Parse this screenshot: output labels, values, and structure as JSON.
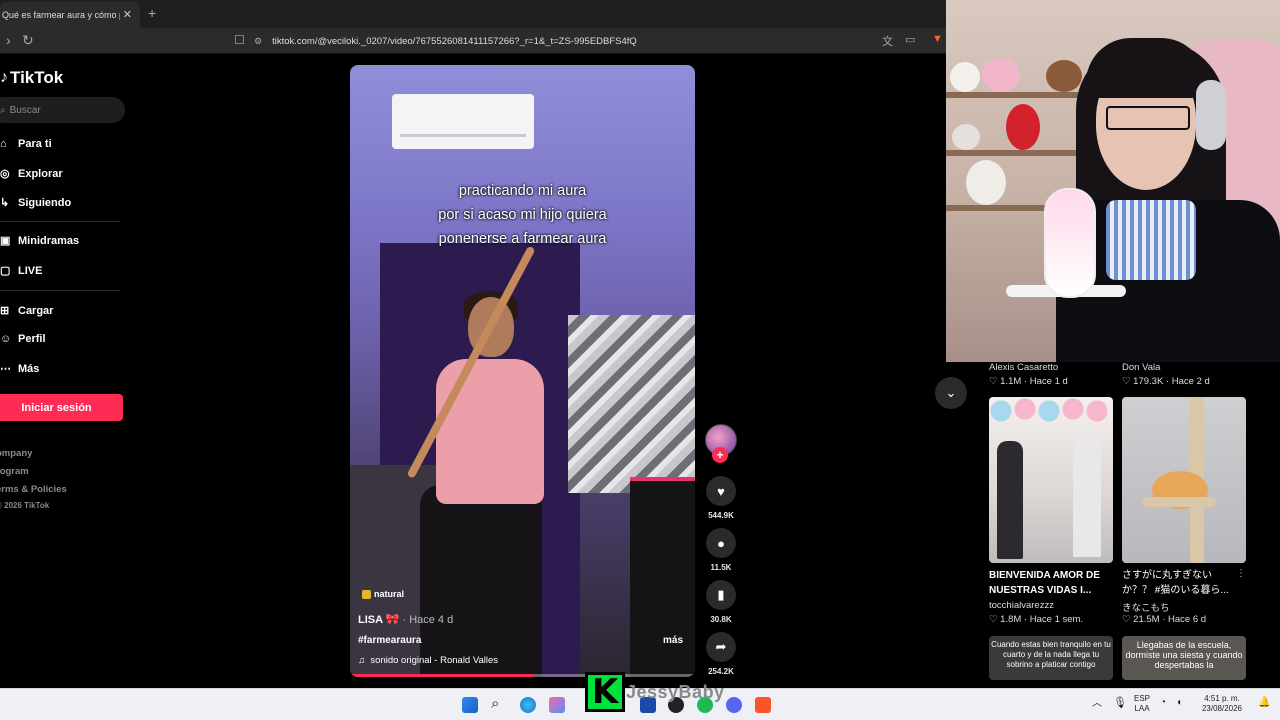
{
  "browser": {
    "tab_title": "Qué es farmear aura y cómo pra",
    "tab_close": "✕",
    "new_tab": "+",
    "url": "tiktok.com/@veciloki._0207/video/7675526081411157266?_r=1&_t=ZS-995EDBFS4fQ"
  },
  "sidebar": {
    "logo": "TikTok",
    "search_placeholder": "Buscar",
    "items": [
      {
        "label": "Para ti",
        "icon": "home-icon"
      },
      {
        "label": "Explorar",
        "icon": "compass-icon"
      },
      {
        "label": "Siguiendo",
        "icon": "following-icon"
      },
      {
        "label": "Minidramas",
        "icon": "minidramas-icon"
      },
      {
        "label": "LIVE",
        "icon": "live-icon"
      },
      {
        "label": "Cargar",
        "icon": "upload-icon"
      },
      {
        "label": "Perfil",
        "icon": "profile-icon"
      },
      {
        "label": "Más",
        "icon": "more-icon"
      }
    ],
    "login_button": "Iniciar sesión",
    "footer": [
      "ompany",
      "rogram",
      "erms & Policies"
    ],
    "copyright": "2026 TikTok"
  },
  "video": {
    "caption_lines": [
      "practicando mi aura",
      "por si acaso mi hijo quiera",
      "ponenerse a farmear aura"
    ],
    "tag": "natural",
    "author": "LISA 🎀",
    "time": "· Hace 4 d",
    "hashtag": "#farmearaura",
    "more": "más",
    "music": "sonido original - Ronald Valles",
    "progress_fraction": 0.53
  },
  "actions": {
    "likes": "544.9K",
    "comments": "11.5K",
    "saves": "30.8K",
    "shares": "254.2K"
  },
  "recommendations": {
    "top_row": [
      {
        "author": "Alexis Casaretto",
        "likes": "1.1M",
        "time": "Hace 1 d"
      },
      {
        "author": "Don Vala",
        "likes": "179.3K",
        "time": "Hace 2 d"
      }
    ],
    "cards": [
      {
        "title": "BIENVENIDA AMOR DE NUESTRAS VIDAS I...",
        "author": "tocchialvarezzz",
        "likes": "1.8M",
        "time": "Hace 1 sem."
      },
      {
        "title": "さすがに丸すぎない か？？ #猫のいる暮ら...",
        "author": "きなこもち",
        "likes": "21.5M",
        "time": "Hace 6 d"
      }
    ],
    "bottom_cards": [
      {
        "text": "Cuando estas bien tranquilo en tu cuarto y de la nada llega tu sobrino a platicar contigo"
      },
      {
        "text": "Llegabas de la escuela, dormiste una siesta y cuando despertabas la"
      }
    ]
  },
  "taskbar": {
    "lang_top": "ESP",
    "lang_bottom": "LAA",
    "time": "4:51 p. m.",
    "date": "23/08/2026"
  },
  "overlay": {
    "letter": "K",
    "name": "JessyBaby"
  },
  "colors": {
    "accent": "#fe2c55",
    "background": "#000000"
  }
}
